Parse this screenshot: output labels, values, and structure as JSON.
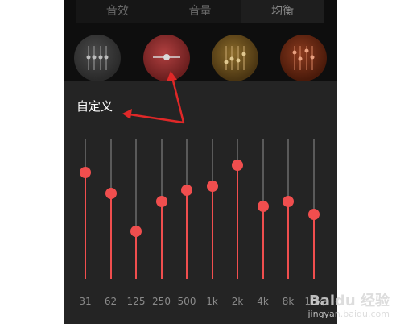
{
  "tabs": [
    {
      "label": "音效",
      "active": false
    },
    {
      "label": "音量",
      "active": false
    },
    {
      "label": "均衡",
      "active": true
    }
  ],
  "presets": [
    {
      "name": "neutral-preset",
      "color": "#3a3a3a"
    },
    {
      "name": "custom-preset",
      "color": "#8e2e2e"
    },
    {
      "name": "gold-preset",
      "color": "#6a5020"
    },
    {
      "name": "copper-preset",
      "color": "#6a2a12"
    }
  ],
  "custom_label": "自定义",
  "accent_color": "#f04e4e",
  "eq": {
    "bands": [
      {
        "label": "31",
        "level": 0.76
      },
      {
        "label": "62",
        "level": 0.61
      },
      {
        "label": "125",
        "level": 0.34
      },
      {
        "label": "250",
        "level": 0.55
      },
      {
        "label": "500",
        "level": 0.63
      },
      {
        "label": "1k",
        "level": 0.66
      },
      {
        "label": "2k",
        "level": 0.81
      },
      {
        "label": "4k",
        "level": 0.52
      },
      {
        "label": "8k",
        "level": 0.55
      },
      {
        "label": "16k",
        "level": 0.46
      }
    ]
  },
  "watermark": {
    "main": "Baidu 经验",
    "sub": "jingyan.baidu.com"
  }
}
